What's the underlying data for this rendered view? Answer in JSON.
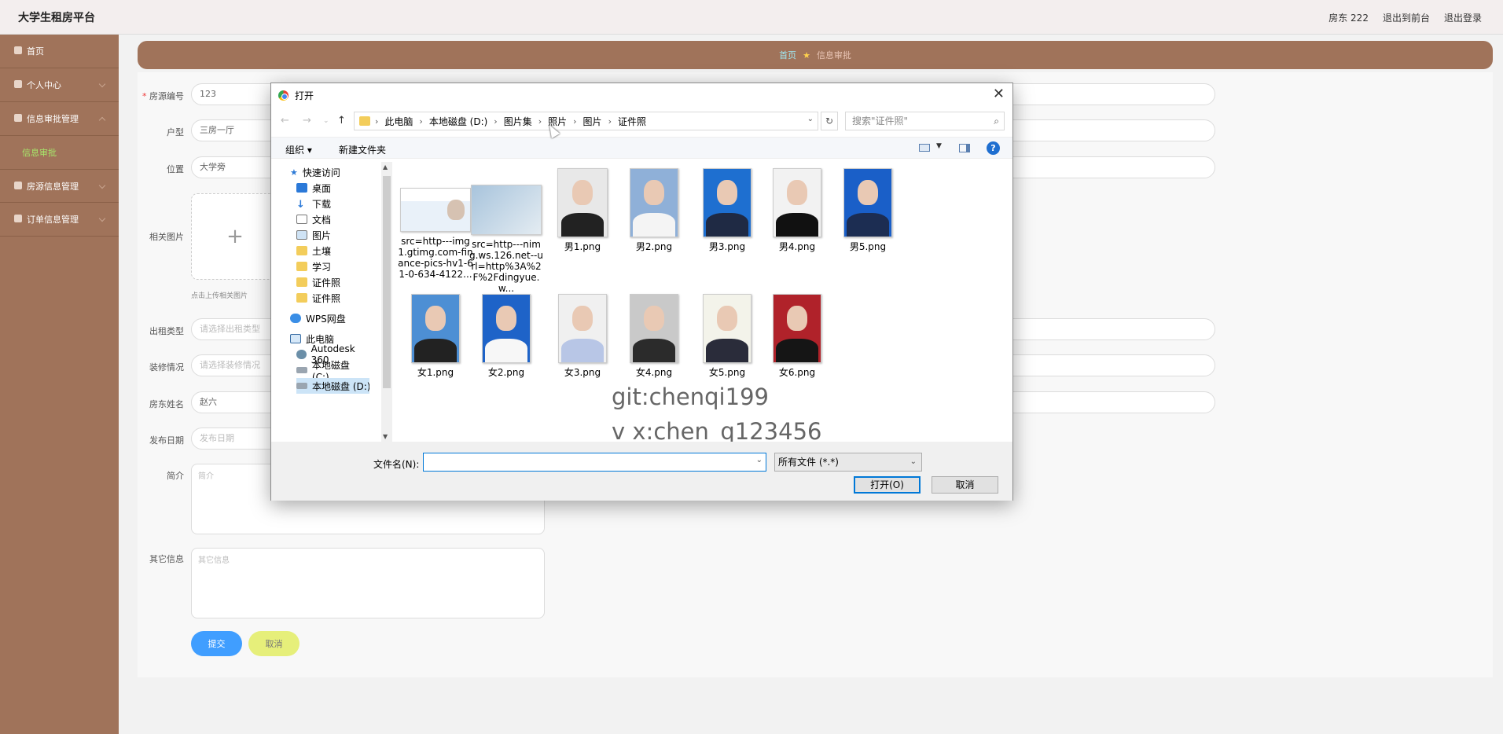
{
  "header": {
    "brand": "大学生租房平台",
    "user": "房东 222",
    "to_front": "退出到前台",
    "logout": "退出登录"
  },
  "sidebar": {
    "items": [
      {
        "label": "首页"
      },
      {
        "label": "个人中心"
      },
      {
        "label": "信息审批管理"
      },
      {
        "label": "信息审批",
        "active": true
      },
      {
        "label": "房源信息管理"
      },
      {
        "label": "订单信息管理"
      }
    ]
  },
  "breadcrumb": {
    "home": "首页",
    "current": "信息审批"
  },
  "form": {
    "house_no_label": "房源编号",
    "house_no_value": "123",
    "layout_label": "户型",
    "layout_value": "三房一厅",
    "location_label": "位置",
    "location_value": "大学旁",
    "images_label": "相关图片",
    "upload_plus": "+",
    "upload_hint": "点击上传相关图片",
    "rent_type_label": "出租类型",
    "rent_type_placeholder": "请选择出租类型",
    "decor_label": "装修情况",
    "decor_placeholder": "请选择装修情况",
    "landlord_label": "房东姓名",
    "landlord_value": "赵六",
    "date_label": "发布日期",
    "date_placeholder": "发布日期",
    "intro_label": "简介",
    "intro_placeholder": "简介",
    "other_label": "其它信息",
    "other_placeholder": "其它信息",
    "submit": "提交",
    "cancel": "取消"
  },
  "dialog": {
    "title": "打开",
    "close": "✕",
    "path": [
      "此电脑",
      "本地磁盘 (D:)",
      "图片集",
      "照片",
      "图片",
      "证件照"
    ],
    "search_placeholder": "搜索\"证件照\"",
    "organize": "组织 ▾",
    "new_folder": "新建文件夹",
    "help": "?",
    "nav": [
      {
        "label": "快速访问",
        "icon": "star-icon"
      },
      {
        "label": "桌面",
        "icon": "desktop-icon",
        "pinned": true
      },
      {
        "label": "下载",
        "icon": "download-icon",
        "pinned": true
      },
      {
        "label": "文档",
        "icon": "document-icon",
        "pinned": true
      },
      {
        "label": "图片",
        "icon": "picture-icon",
        "pinned": true
      },
      {
        "label": "土壤",
        "icon": "folder-icon"
      },
      {
        "label": "学习",
        "icon": "folder-icon"
      },
      {
        "label": "证件照",
        "icon": "folder-icon"
      },
      {
        "label": "证件照",
        "icon": "folder-icon"
      },
      {
        "label": "WPS网盘",
        "icon": "cloud-icon"
      },
      {
        "label": "此电脑",
        "icon": "computer-icon"
      },
      {
        "label": "Autodesk 360",
        "icon": "autodesk-icon"
      },
      {
        "label": "本地磁盘 (C:)",
        "icon": "drive-icon"
      },
      {
        "label": "本地磁盘 (D:)",
        "icon": "drive-icon"
      }
    ],
    "files": [
      {
        "name": "src=http---img1.gtimg.com-finance-pics-hv1-61-0-634-4122...",
        "kind": "card"
      },
      {
        "name": "src=http---nimg.ws.126.net--url=http%3A%2F%2Fdingyue.w...",
        "kind": "idcard"
      },
      {
        "name": "男1.png",
        "bg": "#e8e8e8"
      },
      {
        "name": "男2.png",
        "bg": "#8fb0d8"
      },
      {
        "name": "男3.png",
        "bg": "#1e6fd0"
      },
      {
        "name": "男4.png",
        "bg": "#f2f2f2"
      },
      {
        "name": "男5.png",
        "bg": "#1a5fc8"
      },
      {
        "name": "女1.png",
        "bg": "#4d8fd4"
      },
      {
        "name": "女2.png",
        "bg": "#1e63c8"
      },
      {
        "name": "女3.png",
        "bg": "#f0f0f0"
      },
      {
        "name": "女4.png",
        "bg": "#c9c9c9"
      },
      {
        "name": "女5.png",
        "bg": "#f3f3ea"
      },
      {
        "name": "女6.png",
        "bg": "#b0222a"
      }
    ],
    "watermark_1": "git:chenqi199",
    "watermark_2": "v x:chen_q123456",
    "filename_label": "文件名(N):",
    "filename_value": "",
    "filetype": "所有文件 (*.*)",
    "open_button": "打开(O)",
    "cancel_button": "取消"
  }
}
